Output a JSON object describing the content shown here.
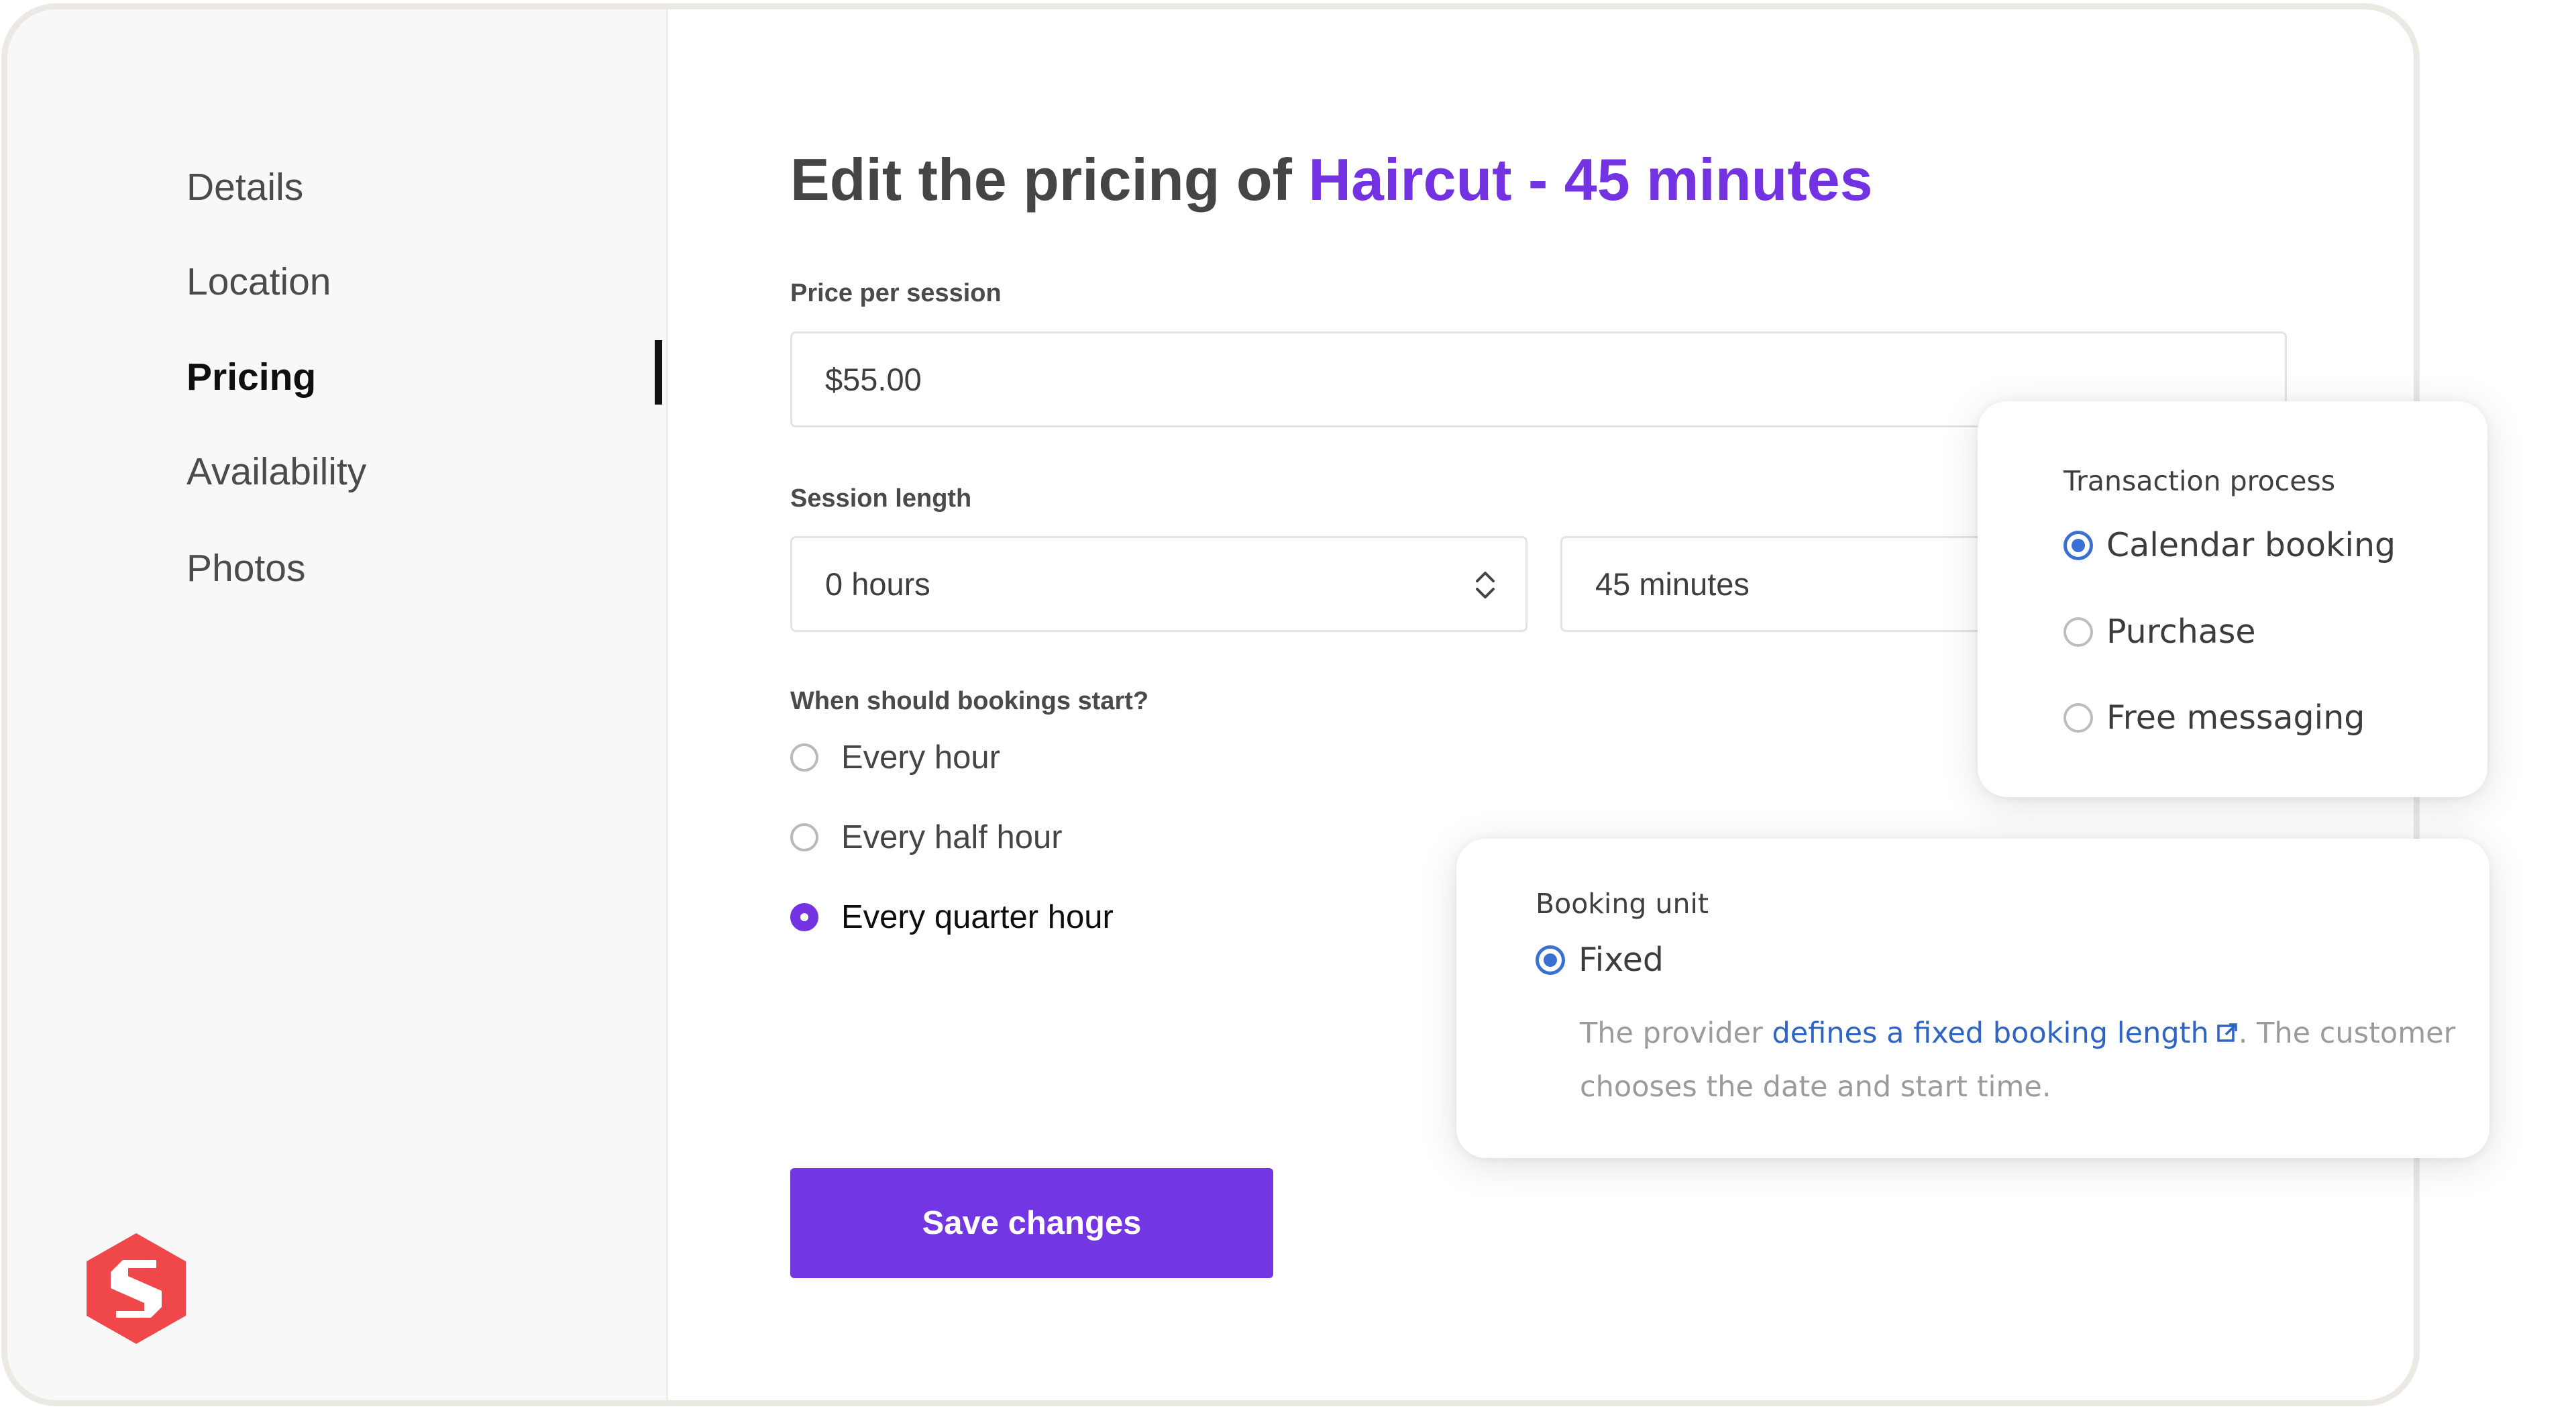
{
  "sidebar": {
    "items": [
      {
        "label": "Details"
      },
      {
        "label": "Location"
      },
      {
        "label": "Pricing",
        "active": true
      },
      {
        "label": "Availability"
      },
      {
        "label": "Photos"
      }
    ],
    "logo_icon": "sharetribe-logo-icon"
  },
  "main": {
    "title_prefix": "Edit the pricing of ",
    "title_highlight": "Haircut - 45 minutes",
    "price": {
      "label": "Price per session",
      "value": "$55.00"
    },
    "session_length": {
      "label": "Session length",
      "hours_value": "0 hours",
      "minutes_value": "45 minutes"
    },
    "booking_start": {
      "label": "When should bookings start?",
      "options": [
        {
          "label": "Every hour",
          "selected": false
        },
        {
          "label": "Every half hour",
          "selected": false
        },
        {
          "label": "Every quarter hour",
          "selected": true
        }
      ]
    },
    "save_label": "Save changes"
  },
  "transaction_card": {
    "label": "Transaction process",
    "options": [
      {
        "label": "Calendar booking",
        "selected": true
      },
      {
        "label": "Purchase",
        "selected": false
      },
      {
        "label": "Free messaging",
        "selected": false
      }
    ]
  },
  "booking_unit_card": {
    "label": "Booking unit",
    "option_label": "Fixed",
    "description_before": "The provider ",
    "description_link": "defines a fixed booking length",
    "description_after": ". The customer chooses the date and start time."
  },
  "colors": {
    "accent_purple": "#7433e2",
    "link_blue": "#2f64c7",
    "logo_red": "#f0474b"
  }
}
